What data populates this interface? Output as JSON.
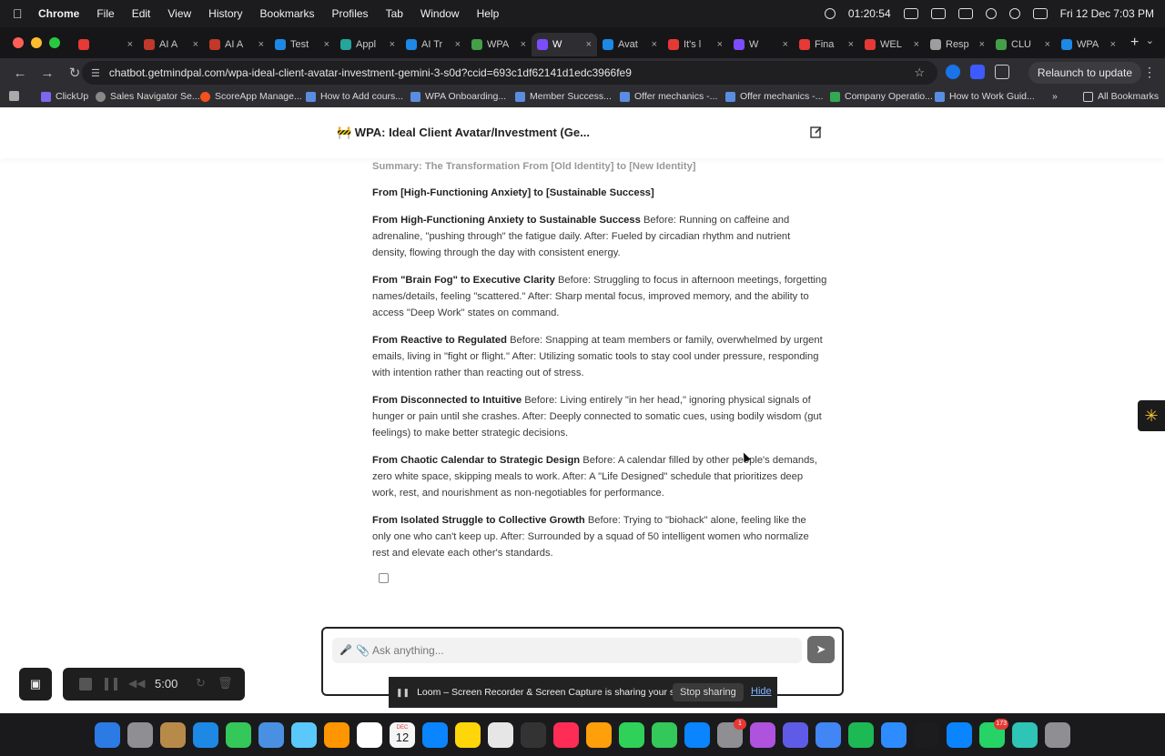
{
  "menubar": {
    "app": "Chrome",
    "items": [
      "File",
      "Edit",
      "View",
      "History",
      "Bookmarks",
      "Profiles",
      "Tab",
      "Window",
      "Help"
    ],
    "time_status": "01:20:54",
    "datetime": "Fri 12 Dec  7:03 PM"
  },
  "tabs": [
    {
      "label": "",
      "color": "#e53935"
    },
    {
      "label": "AI A",
      "color": "#c0392b"
    },
    {
      "label": "AI A",
      "color": "#c0392b"
    },
    {
      "label": "Test",
      "color": "#1e88e5"
    },
    {
      "label": "Appl",
      "color": "#26a69a"
    },
    {
      "label": "AI Tr",
      "color": "#1e88e5"
    },
    {
      "label": "WPA",
      "color": "#43a047"
    },
    {
      "label": "W",
      "color": "#7c4dff",
      "active": true
    },
    {
      "label": "Avat",
      "color": "#1e88e5"
    },
    {
      "label": "It's l",
      "color": "#e53935"
    },
    {
      "label": "W",
      "color": "#7c4dff"
    },
    {
      "label": "Fina",
      "color": "#e53935"
    },
    {
      "label": "WEL",
      "color": "#e53935"
    },
    {
      "label": "Resp",
      "color": "#9e9e9e"
    },
    {
      "label": "CLU",
      "color": "#43a047"
    },
    {
      "label": "WPA",
      "color": "#1e88e5"
    }
  ],
  "address": {
    "url": "chatbot.getmindpal.com/wpa-ideal-client-avatar-investment-gemini-3-s0d?ccid=693c1df62141d1edc3966fe9",
    "relaunch": "Relaunch to update"
  },
  "bookmarks": {
    "items": [
      "ClickUp",
      "Sales Navigator Se...",
      "ScoreApp Manage...",
      "How to Add cours...",
      "WPA Onboarding...",
      "Member Success...",
      "Offer mechanics -...",
      "Offer mechanics -...",
      "Company Operatio...",
      "How to Work Guid..."
    ],
    "all": "All Bookmarks"
  },
  "chat": {
    "title": "🚧 WPA: Ideal Client Avatar/Investment (Ge...",
    "summary": "Summary: The Transformation From [Old Identity] to [New Identity]",
    "heading": "From [High-Functioning Anxiety] to [Sustainable Success]",
    "items": [
      {
        "bold": "From High-Functioning Anxiety to Sustainable Success",
        "text": " Before: Running on caffeine and adrenaline, \"pushing through\" the fatigue daily. After: Fueled by circadian rhythm and nutrient density, flowing through the day with consistent energy."
      },
      {
        "bold": "From \"Brain Fog\" to Executive Clarity",
        "text": " Before: Struggling to focus in afternoon meetings, forgetting names/details, feeling \"scattered.\" After: Sharp mental focus, improved memory, and the ability to access \"Deep Work\" states on command."
      },
      {
        "bold": "From Reactive to Regulated",
        "text": " Before: Snapping at team members or family, overwhelmed by urgent emails, living in \"fight or flight.\" After: Utilizing somatic tools to stay cool under pressure, responding with intention rather than reacting out of stress."
      },
      {
        "bold": "From Disconnected to Intuitive",
        "text": " Before: Living entirely \"in her head,\" ignoring physical signals of hunger or pain until she crashes. After: Deeply connected to somatic cues, using bodily wisdom (gut feelings) to make better strategic decisions."
      },
      {
        "bold": "From Chaotic Calendar to Strategic Design",
        "text": " Before: A calendar filled by other people's demands, zero white space, skipping meals to work. After: A \"Life Designed\" schedule that prioritizes deep work, rest, and nourishment as non-negotiables for performance."
      },
      {
        "bold": "From Isolated Struggle to Collective Growth",
        "text": " Before: Trying to \"biohack\" alone, feeling like the only one who can't keep up. After: Surrounded by a squad of 50 intelligent women who normalize rest and elevate each other's standards."
      }
    ],
    "input_placeholder": "Ask anything..."
  },
  "loom": {
    "message": "Loom – Screen Recorder & Screen Capture is sharing your screen.",
    "stop": "Stop sharing",
    "hide": "Hide"
  },
  "recorder": {
    "time": "5:00"
  },
  "dock": {
    "icons": [
      "#2c7be5",
      "#8e8e93",
      "#b88a4a",
      "#1e88e5",
      "#34c759",
      "#4a90e2",
      "#5ac8fa",
      "#ff9500",
      "#ffffff",
      "#f5f5f5",
      "#0a84ff",
      "#ffd60a",
      "#e6e6e6",
      "#333333",
      "#ff2d55",
      "#ff9f0a",
      "#30d158",
      "#34c759",
      "#0a84ff",
      "#8e8e93",
      "#af52de",
      "#5e5ce6",
      "#4285f4",
      "#1db954",
      "#2d8cff",
      "#1c1c1e",
      "#0a84ff",
      "#25d366",
      "#2ec4b6",
      "#8e8e93"
    ],
    "calendar_day": "12",
    "calendar_month": "DEC",
    "badge_a": "1",
    "badge_b": "173"
  }
}
